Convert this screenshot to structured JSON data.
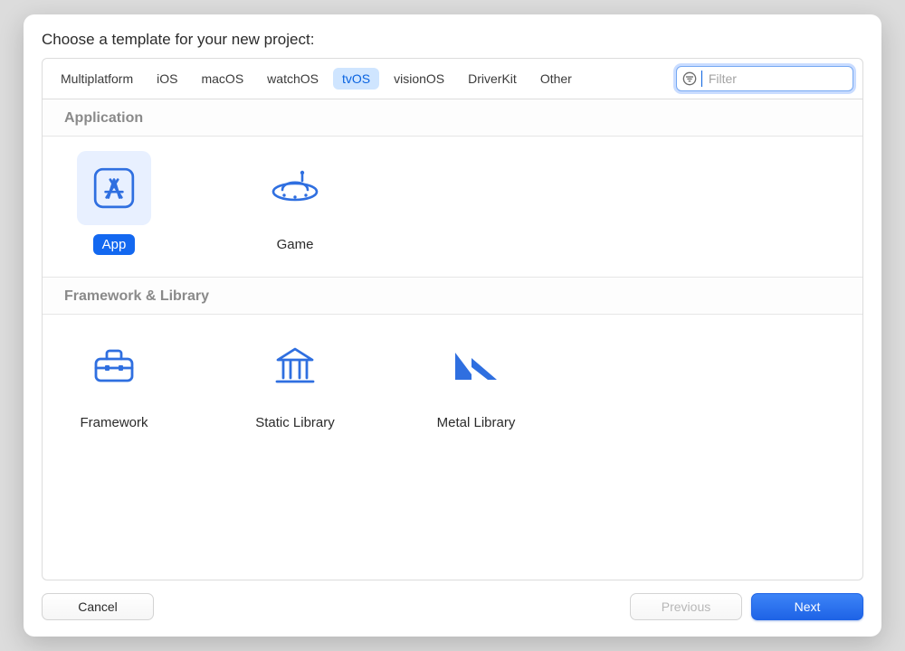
{
  "title": "Choose a template for your new project:",
  "tabs": [
    {
      "label": "Multiplatform"
    },
    {
      "label": "iOS"
    },
    {
      "label": "macOS"
    },
    {
      "label": "watchOS"
    },
    {
      "label": "tvOS",
      "selected": true
    },
    {
      "label": "visionOS"
    },
    {
      "label": "DriverKit"
    },
    {
      "label": "Other"
    }
  ],
  "filter": {
    "placeholder": "Filter",
    "value": ""
  },
  "sections": [
    {
      "heading": "Application",
      "templates": [
        {
          "label": "App",
          "icon": "app-icon",
          "selected": true
        },
        {
          "label": "Game",
          "icon": "ufo-icon"
        }
      ]
    },
    {
      "heading": "Framework & Library",
      "templates": [
        {
          "label": "Framework",
          "icon": "toolbox-icon"
        },
        {
          "label": "Static Library",
          "icon": "library-icon"
        },
        {
          "label": "Metal Library",
          "icon": "metal-icon"
        }
      ]
    }
  ],
  "buttons": {
    "cancel": "Cancel",
    "previous": "Previous",
    "next": "Next"
  }
}
